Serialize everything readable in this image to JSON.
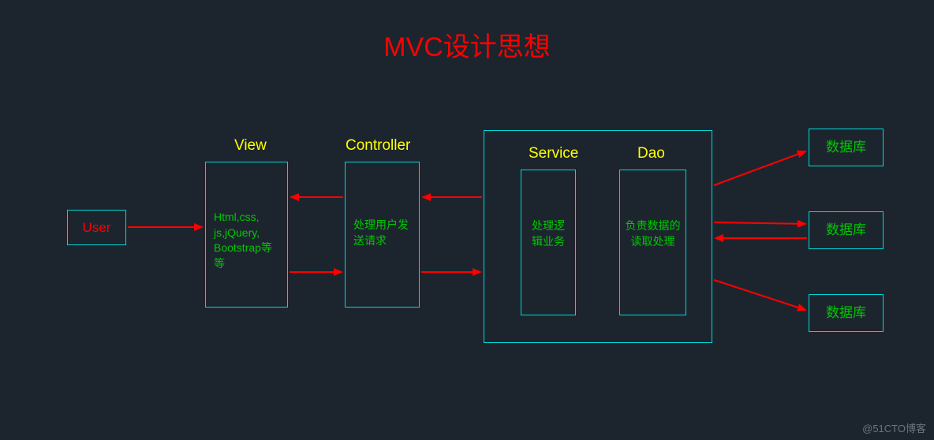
{
  "title": "MVC设计思想",
  "user": {
    "label": "User"
  },
  "view": {
    "title": "View",
    "body": "Html,css,\njs,jQuery,\nBootstrap等\n等"
  },
  "controller": {
    "title": "Controller",
    "body": "处理用户发\n送请求"
  },
  "service": {
    "title": "Service",
    "body": "处理逻\n辑业务"
  },
  "dao": {
    "title": "Dao",
    "body": "负责数据的\n读取处理"
  },
  "db": {
    "label1": "数据库",
    "label2": "数据库",
    "label3": "数据库"
  },
  "watermark": "@51CTO博客"
}
